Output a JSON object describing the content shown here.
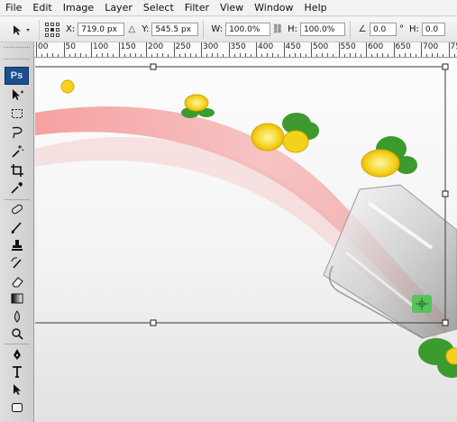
{
  "menu": [
    "File",
    "Edit",
    "Image",
    "Layer",
    "Select",
    "Filter",
    "View",
    "Window",
    "Help"
  ],
  "options": {
    "x_label": "X:",
    "x_value": "719.0 px",
    "y_label": "Y:",
    "y_value": "545.5 px",
    "w_label": "W:",
    "w_value": "100.0%",
    "h_label": "H:",
    "h_value": "100.0%",
    "angle_value": "0.0",
    "degree_symbol": "°",
    "h2_label": "H:",
    "h2_value": "0.0"
  },
  "ruler_labels": [
    "00",
    "50",
    "100",
    "150",
    "200",
    "250",
    "300",
    "350",
    "400",
    "450",
    "500",
    "550",
    "600",
    "650",
    "700",
    "750"
  ],
  "tools_panel": {
    "logo": "Ps",
    "tools": [
      "move-tool",
      "marquee-tool",
      "lasso-tool",
      "magic-wand-tool",
      "crop-tool",
      "eyedropper-tool",
      "healing-brush-tool",
      "brush-tool",
      "clone-stamp-tool",
      "history-brush-tool",
      "eraser-tool",
      "gradient-tool",
      "blur-tool",
      "dodge-tool",
      "pen-tool",
      "type-tool",
      "path-selection-tool",
      "shape-tool"
    ]
  },
  "colors": {
    "accent_green": "#55c45a",
    "stripe_pink": "#f36d6d",
    "lemon_yellow": "#f4d21c",
    "mint_green": "#3c9a2e"
  }
}
